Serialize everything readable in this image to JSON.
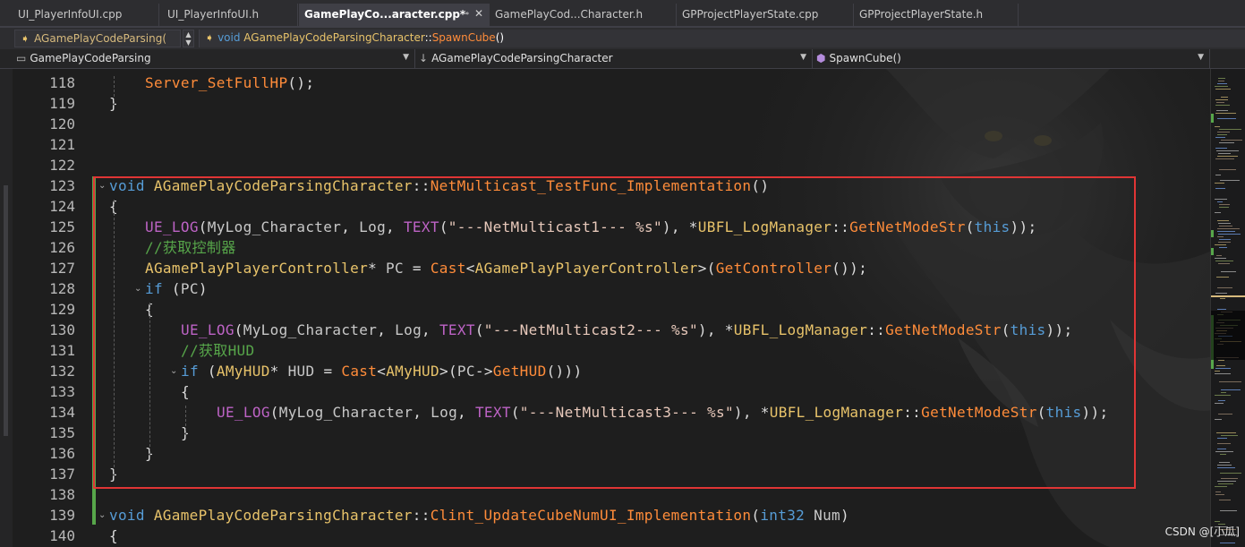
{
  "tabs": [
    {
      "label": "UI_PlayerInfoUI.cpp",
      "active": false
    },
    {
      "label": "UI_PlayerInfoUI.h",
      "active": false
    },
    {
      "label": "GamePlayCo...aracter.cpp*",
      "active": true
    },
    {
      "label": "GamePlayCod...Character.h",
      "active": false
    },
    {
      "label": "GPProjectPlayerState.cpp",
      "active": false
    },
    {
      "label": "GPProjectPlayerState.h",
      "active": false
    }
  ],
  "toolbar": {
    "class_dropdown": "AGamePlayCodeParsing(",
    "function_keyword": "void",
    "function_class": "AGamePlayCodeParsingCharacter",
    "function_sep": "::",
    "function_name": "SpawnCube",
    "function_parens": "()"
  },
  "navbar": {
    "project": "GamePlayCodeParsing",
    "scope": "AGamePlayCodeParsingCharacter",
    "member": "SpawnCube()"
  },
  "editor": {
    "lines": [
      {
        "n": 118,
        "indent": 1,
        "tokens": [
          [
            "fn",
            "Server_SetFullHP"
          ],
          [
            "",
            "();"
          ]
        ]
      },
      {
        "n": 119,
        "indent": 0,
        "tokens": [
          [
            "",
            "}"
          ]
        ]
      },
      {
        "n": 120,
        "indent": 0,
        "tokens": []
      },
      {
        "n": 121,
        "indent": 0,
        "tokens": []
      },
      {
        "n": 122,
        "indent": 0,
        "tokens": []
      },
      {
        "n": 123,
        "indent": 0,
        "fold": true,
        "tokens": [
          [
            "kw",
            "void"
          ],
          [
            "",
            " "
          ],
          [
            "ty",
            "AGamePlayCodeParsingCharacter"
          ],
          [
            "",
            "::"
          ],
          [
            "fn",
            "NetMulticast_TestFunc_Implementation"
          ],
          [
            "",
            "()"
          ]
        ]
      },
      {
        "n": 124,
        "indent": 0,
        "tokens": [
          [
            "",
            "{"
          ]
        ]
      },
      {
        "n": 125,
        "indent": 1,
        "tokens": [
          [
            "mac",
            "UE_LOG"
          ],
          [
            "",
            "("
          ],
          [
            "var",
            "MyLog_Character"
          ],
          [
            "",
            ", "
          ],
          [
            "var",
            "Log"
          ],
          [
            "",
            ", "
          ],
          [
            "mac",
            "TEXT"
          ],
          [
            "",
            "("
          ],
          [
            "str",
            "\"---NetMulticast1--- %s\""
          ],
          [
            "",
            "), *"
          ],
          [
            "ty",
            "UBFL_LogManager"
          ],
          [
            "",
            "::"
          ],
          [
            "fn",
            "GetNetModeStr"
          ],
          [
            "",
            "("
          ],
          [
            "kw",
            "this"
          ],
          [
            "",
            "));"
          ]
        ]
      },
      {
        "n": 126,
        "indent": 1,
        "tokens": [
          [
            "cmt",
            "//获取控制器"
          ]
        ]
      },
      {
        "n": 127,
        "indent": 1,
        "tokens": [
          [
            "ty",
            "AGamePlayPlayerController"
          ],
          [
            "",
            "* "
          ],
          [
            "var",
            "PC"
          ],
          [
            "",
            " = "
          ],
          [
            "fn",
            "Cast"
          ],
          [
            "",
            "<"
          ],
          [
            "ty",
            "AGamePlayPlayerController"
          ],
          [
            "",
            ">("
          ],
          [
            "fn",
            "GetController"
          ],
          [
            "",
            "());"
          ]
        ]
      },
      {
        "n": 128,
        "indent": 1,
        "fold": true,
        "tokens": [
          [
            "kw",
            "if"
          ],
          [
            "",
            " ("
          ],
          [
            "var",
            "PC"
          ],
          [
            "",
            ")"
          ]
        ]
      },
      {
        "n": 129,
        "indent": 1,
        "tokens": [
          [
            "",
            "{"
          ]
        ]
      },
      {
        "n": 130,
        "indent": 2,
        "tokens": [
          [
            "mac",
            "UE_LOG"
          ],
          [
            "",
            "("
          ],
          [
            "var",
            "MyLog_Character"
          ],
          [
            "",
            ", "
          ],
          [
            "var",
            "Log"
          ],
          [
            "",
            ", "
          ],
          [
            "mac",
            "TEXT"
          ],
          [
            "",
            "("
          ],
          [
            "str",
            "\"---NetMulticast2--- %s\""
          ],
          [
            "",
            "), *"
          ],
          [
            "ty",
            "UBFL_LogManager"
          ],
          [
            "",
            "::"
          ],
          [
            "fn",
            "GetNetModeStr"
          ],
          [
            "",
            "("
          ],
          [
            "kw",
            "this"
          ],
          [
            "",
            "));"
          ]
        ]
      },
      {
        "n": 131,
        "indent": 2,
        "tokens": [
          [
            "cmt",
            "//获取HUD"
          ]
        ]
      },
      {
        "n": 132,
        "indent": 2,
        "fold": true,
        "tokens": [
          [
            "kw",
            "if"
          ],
          [
            "",
            " ("
          ],
          [
            "ty",
            "AMyHUD"
          ],
          [
            "",
            "* "
          ],
          [
            "var",
            "HUD"
          ],
          [
            "",
            " = "
          ],
          [
            "fn",
            "Cast"
          ],
          [
            "",
            "<"
          ],
          [
            "ty",
            "AMyHUD"
          ],
          [
            "",
            ">("
          ],
          [
            "var",
            "PC"
          ],
          [
            "",
            "->"
          ],
          [
            "fn",
            "GetHUD"
          ],
          [
            "",
            "()))"
          ]
        ]
      },
      {
        "n": 133,
        "indent": 2,
        "tokens": [
          [
            "",
            "{"
          ]
        ]
      },
      {
        "n": 134,
        "indent": 3,
        "tokens": [
          [
            "mac",
            "UE_LOG"
          ],
          [
            "",
            "("
          ],
          [
            "var",
            "MyLog_Character"
          ],
          [
            "",
            ", "
          ],
          [
            "var",
            "Log"
          ],
          [
            "",
            ", "
          ],
          [
            "mac",
            "TEXT"
          ],
          [
            "",
            "("
          ],
          [
            "str",
            "\"---NetMulticast3--- %s\""
          ],
          [
            "",
            "), *"
          ],
          [
            "ty",
            "UBFL_LogManager"
          ],
          [
            "",
            "::"
          ],
          [
            "fn",
            "GetNetModeStr"
          ],
          [
            "",
            "("
          ],
          [
            "kw",
            "this"
          ],
          [
            "",
            "));"
          ]
        ]
      },
      {
        "n": 135,
        "indent": 2,
        "tokens": [
          [
            "",
            "}"
          ]
        ]
      },
      {
        "n": 136,
        "indent": 1,
        "tokens": [
          [
            "",
            "}"
          ]
        ]
      },
      {
        "n": 137,
        "indent": 0,
        "tokens": [
          [
            "",
            "}"
          ]
        ]
      },
      {
        "n": 138,
        "indent": 0,
        "tokens": []
      },
      {
        "n": 139,
        "indent": 0,
        "fold": true,
        "tokens": [
          [
            "kw",
            "void"
          ],
          [
            "",
            " "
          ],
          [
            "ty",
            "AGamePlayCodeParsingCharacter"
          ],
          [
            "",
            "::"
          ],
          [
            "fn",
            "Clint_UpdateCubeNumUI_Implementation"
          ],
          [
            "",
            "("
          ],
          [
            "kw",
            "int32"
          ],
          [
            "",
            " "
          ],
          [
            "var",
            "Num"
          ],
          [
            "",
            ")"
          ]
        ]
      },
      {
        "n": 140,
        "indent": 0,
        "tokens": [
          [
            "",
            "{"
          ]
        ]
      }
    ]
  },
  "watermark": "CSDN @[小瓜]",
  "colors": {
    "keyword": "#569cd6",
    "type": "#e8c36a",
    "macro": "#bd63c5",
    "function": "#ff8c3a",
    "string": "#e8c9bb",
    "comment": "#57a64a",
    "highlight_box": "#e03535"
  },
  "icons": {
    "tab_pin": "pin-icon",
    "tab_close": "close-icon",
    "class_dropdown": "class-icon",
    "function_dropdown": "method-icon",
    "nav_scope": "scope-arrow-icon",
    "nav_member": "cube-icon"
  }
}
